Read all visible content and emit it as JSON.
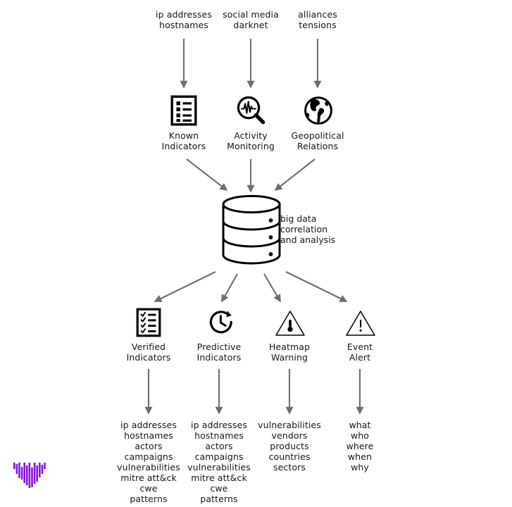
{
  "diagram": {
    "title": "threat intelligence big data correlation flow",
    "colors": {
      "arrow": "#6e6e6e",
      "icon": "#000000",
      "text": "#161616",
      "logo": "#8A13E8",
      "background": "#ffffff"
    },
    "sources": [
      {
        "name": "ip-addresses-hostnames",
        "text": "ip addresses\nhostnames"
      },
      {
        "name": "social-media-darknet",
        "text": "social media\ndarknet"
      },
      {
        "name": "alliances-tensions",
        "text": "alliances\ntensions"
      }
    ],
    "collectors": [
      {
        "name": "known-indicators",
        "icon": "document-list-icon",
        "label": "Known\nIndicators"
      },
      {
        "name": "activity-monitoring",
        "icon": "magnifier-waveform-icon",
        "label": "Activity\nMonitoring"
      },
      {
        "name": "geopolitical-relations",
        "icon": "globe-icon",
        "label": "Geopolitical\nRelations"
      }
    ],
    "hub": {
      "name": "big-data-store",
      "icon": "database-cylinder-icon",
      "label": "big data\ncorrelation\nand analysis"
    },
    "outputs": [
      {
        "name": "verified-indicators",
        "icon": "checklist-icon",
        "label": "Verified\nIndicators",
        "items": "ip addresses\nhostnames\nactors\ncampaigns\nvulnerabilities\nmitre att&ck\ncwe\npatterns"
      },
      {
        "name": "predictive-indicators",
        "icon": "clock-arrow-icon",
        "label": "Predictive\nIndicators",
        "items": "ip addresses\nhostnames\nactors\ncampaigns\nvulnerabilities\nmitre att&ck\ncwe\npatterns"
      },
      {
        "name": "heatmap-warning",
        "icon": "warning-thermometer-icon",
        "label": "Heatmap\nWarning",
        "items": "vulnerabilities\nvendors\nproducts\ncountries\nsectors"
      },
      {
        "name": "event-alert",
        "icon": "warning-exclamation-icon",
        "label": "Event\nAlert",
        "items": "what\nwho\nwhere\nwhen\nwhy"
      }
    ],
    "logo": {
      "name": "brand-logo",
      "alt": "violet bar triangle logo"
    }
  }
}
